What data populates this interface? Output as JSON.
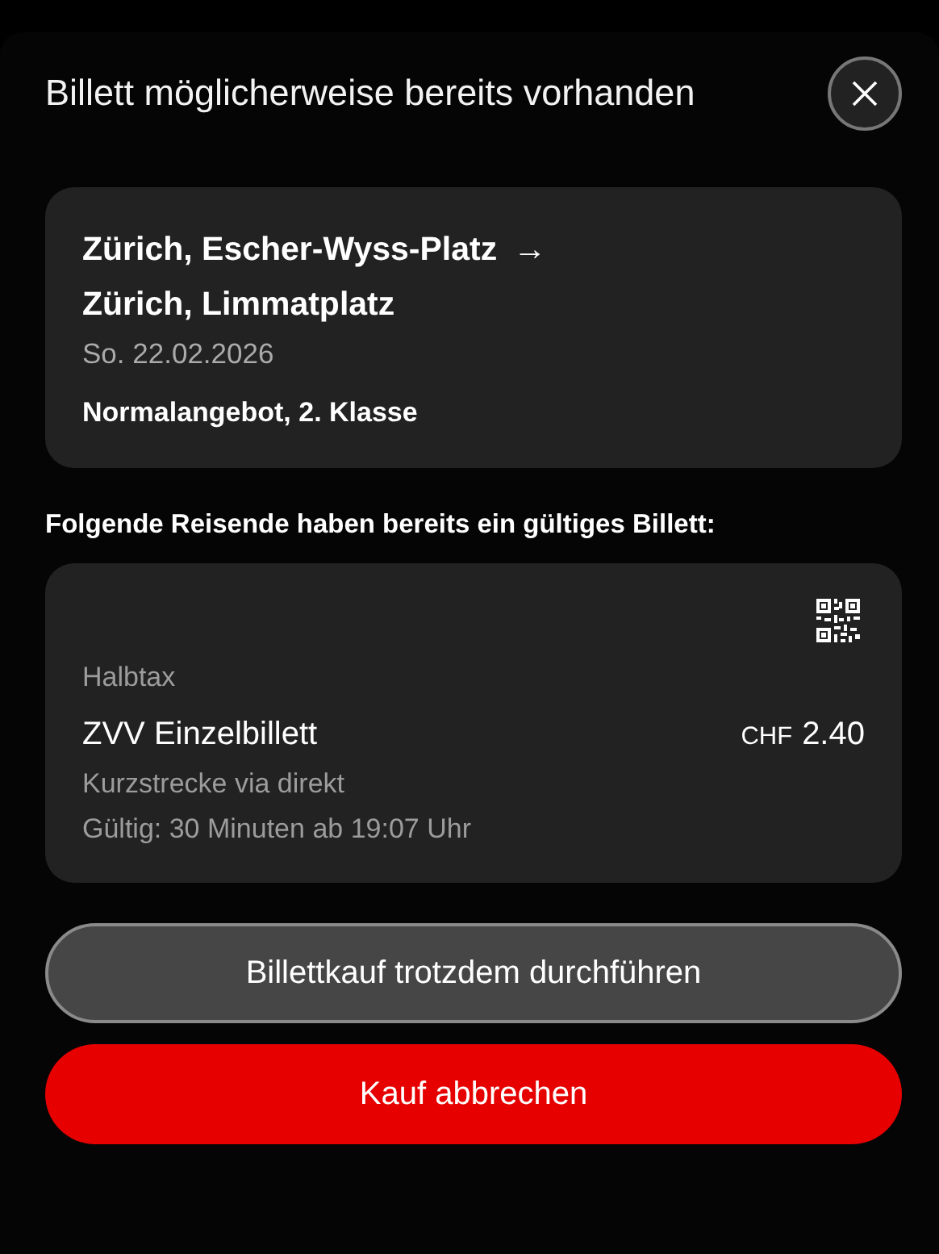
{
  "dialog": {
    "title": "Billett möglicherweise bereits vorhanden"
  },
  "journey": {
    "from": "Zürich, Escher-Wyss-Platz",
    "arrow": "→",
    "to": "Zürich, Limmatplatz",
    "date": "So. 22.02.2026",
    "offer": "Normalangebot, 2. Klasse"
  },
  "travellers_heading": "Folgende Reisende haben bereits ein gültiges Billett:",
  "tickets": [
    {
      "reduction": "Halbtax",
      "name": "ZVV Einzelbillett",
      "currency": "CHF",
      "amount": "2.40",
      "route": "Kurzstrecke via direkt",
      "validity": "Gültig: 30 Minuten ab 19:07 Uhr"
    }
  ],
  "buttons": [
    {
      "label": "Billettkauf trotzdem durchführen",
      "kind": "secondary"
    },
    {
      "label": "Kauf abbrechen",
      "kind": "danger"
    }
  ]
}
